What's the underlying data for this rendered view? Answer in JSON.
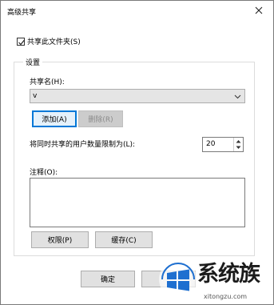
{
  "window": {
    "title": "高级共享"
  },
  "share_checkbox": {
    "label": "共享此文件夹(S)",
    "checked": true
  },
  "settings_group": {
    "title": "设置"
  },
  "share_name": {
    "label": "共享名(H):",
    "value": "v"
  },
  "buttons": {
    "add": "添加(A)",
    "delete": "删除(R)",
    "permissions": "权限(P)",
    "caching": "缓存(C)",
    "ok": "确定"
  },
  "user_limit": {
    "label": "将同时共享的用户数量限制为(L):",
    "value": "20"
  },
  "comment": {
    "label": "注释(O):",
    "value": ""
  },
  "watermark": {
    "text": "系统族",
    "url": "xitongzu.com"
  }
}
